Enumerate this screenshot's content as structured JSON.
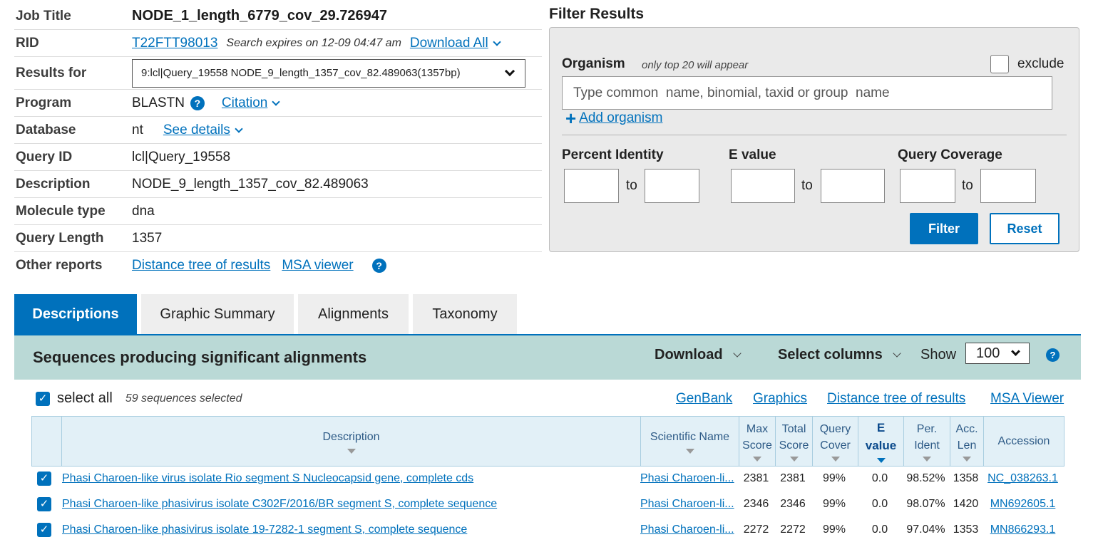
{
  "summary": {
    "job_title_label": "Job Title",
    "job_title_value": "NODE_1_length_6779_cov_29.726947",
    "rid_label": "RID",
    "rid_value": "T22FTT98013",
    "rid_expires": "Search expires on 12-09 04:47 am",
    "download_all": "Download All",
    "results_for_label": "Results for",
    "results_for_value": "9:lcl|Query_19558 NODE_9_length_1357_cov_82.489063(1357bp)",
    "program_label": "Program",
    "program_value": "BLASTN",
    "citation": "Citation",
    "database_label": "Database",
    "database_value": "nt",
    "see_details": "See details",
    "query_id_label": "Query ID",
    "query_id_value": "lcl|Query_19558",
    "description_label": "Description",
    "description_value": "NODE_9_length_1357_cov_82.489063",
    "molecule_label": "Molecule type",
    "molecule_value": "dna",
    "query_length_label": "Query Length",
    "query_length_value": "1357",
    "other_reports_label": "Other reports",
    "distance_tree": "Distance tree of results",
    "msa_viewer": "MSA viewer",
    "help_glyph": "?"
  },
  "filter": {
    "title": "Filter Results",
    "organism_label": "Organism",
    "organism_note": "only top 20 will appear",
    "exclude_label": "exclude",
    "exclude_checked": false,
    "organism_placeholder": "Type common  name, binomial, taxid or group  name",
    "add_organism": "Add organism",
    "plus_glyph": "+",
    "percent_identity_label": "Percent Identity",
    "evalue_label": "E value",
    "query_coverage_label": "Query Coverage",
    "to_label": "to",
    "filter_button": "Filter",
    "reset_button": "Reset"
  },
  "tabs": [
    {
      "label": "Descriptions",
      "active": true
    },
    {
      "label": "Graphic Summary",
      "active": false
    },
    {
      "label": "Alignments",
      "active": false
    },
    {
      "label": "Taxonomy",
      "active": false
    }
  ],
  "results_bar": {
    "title": "Sequences producing significant alignments",
    "download": "Download",
    "select_columns": "Select columns",
    "show_label": "Show",
    "show_value": "100",
    "help_glyph": "?"
  },
  "selection": {
    "select_all_label": "select all",
    "select_all_checked": true,
    "count_text": "59 sequences selected",
    "check_glyph": "✓"
  },
  "links": {
    "genbank": "GenBank",
    "graphics": "Graphics",
    "distance_tree": "Distance tree of results",
    "msa_viewer": "MSA Viewer"
  },
  "table": {
    "headers": {
      "description": "Description",
      "scientific_name": "Scientific Name",
      "max_score_1": "Max",
      "max_score_2": "Score",
      "total_score_1": "Total",
      "total_score_2": "Score",
      "query_cover_1": "Query",
      "query_cover_2": "Cover",
      "evalue_1": "E",
      "evalue_2": "value",
      "per_ident_1": "Per.",
      "per_ident_2": "Ident",
      "acc_len_1": "Acc.",
      "acc_len_2": "Len",
      "accession": "Accession"
    },
    "rows": [
      {
        "description": "Phasi Charoen-like virus isolate Rio segment S Nucleocapsid gene, complete cds",
        "scientific_name": "Phasi Charoen-li...",
        "max_score": "2381",
        "total_score": "2381",
        "query_cover": "99%",
        "evalue": "0.0",
        "per_ident": "98.52%",
        "acc_len": "1358",
        "accession": "NC_038263.1",
        "checked": true
      },
      {
        "description": "Phasi Charoen-like phasivirus isolate C302F/2016/BR segment S, complete sequence",
        "scientific_name": "Phasi Charoen-li...",
        "max_score": "2346",
        "total_score": "2346",
        "query_cover": "99%",
        "evalue": "0.0",
        "per_ident": "98.07%",
        "acc_len": "1420",
        "accession": "MN692605.1",
        "checked": true
      },
      {
        "description": "Phasi Charoen-like phasivirus isolate 19-7282-1 segment S, complete sequence",
        "scientific_name": "Phasi Charoen-li...",
        "max_score": "2272",
        "total_score": "2272",
        "query_cover": "99%",
        "evalue": "0.0",
        "per_ident": "97.04%",
        "acc_len": "1353",
        "accession": "MN866293.1",
        "checked": true
      }
    ]
  },
  "colors": {
    "accent": "#0071bc",
    "results_bar_bg": "#bad9d6",
    "table_header_bg": "#e2f0f7",
    "panel_bg": "#eaeaea"
  }
}
